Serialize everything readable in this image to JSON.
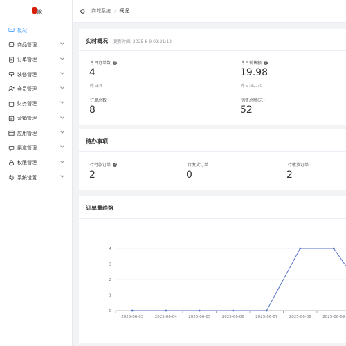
{
  "sidebar": {
    "logo_text": "微",
    "items": [
      {
        "label": "概况",
        "icon": "monitor-icon",
        "active": true,
        "arrow": false
      },
      {
        "label": "商品管理",
        "icon": "goods-icon",
        "active": false,
        "arrow": true
      },
      {
        "label": "订单管理",
        "icon": "order-icon",
        "active": false,
        "arrow": true
      },
      {
        "label": "装修管理",
        "icon": "brush-icon",
        "active": false,
        "arrow": true
      },
      {
        "label": "会员管理",
        "icon": "user-icon",
        "active": false,
        "arrow": true
      },
      {
        "label": "财务管理",
        "icon": "wallet-icon",
        "active": false,
        "arrow": true
      },
      {
        "label": "营销管理",
        "icon": "promo-icon",
        "active": false,
        "arrow": true
      },
      {
        "label": "应用管理",
        "icon": "apps-icon",
        "active": false,
        "arrow": true
      },
      {
        "label": "渠道管理",
        "icon": "channel-icon",
        "active": false,
        "arrow": true
      },
      {
        "label": "权限管理",
        "icon": "lock-icon",
        "active": false,
        "arrow": true
      },
      {
        "label": "系统设置",
        "icon": "gear-icon",
        "active": false,
        "arrow": true
      }
    ]
  },
  "header": {
    "breadcrumb": [
      "商城系统",
      "概况"
    ],
    "separator": "/"
  },
  "realtime": {
    "title": "实时概况",
    "updated": "更新时间: 2025-6-9 02:21:12",
    "stats": [
      {
        "label": "今日订单数",
        "value": "4",
        "sub": "昨日:4",
        "help": true
      },
      {
        "label": "今日销售额",
        "value": "19.98",
        "sub": "昨日:32.70",
        "help": true
      },
      {
        "label": "订单总数",
        "value": "8",
        "sub": "",
        "help": false
      },
      {
        "label": "销售总额(元)",
        "value": "52",
        "sub": "",
        "help": false
      }
    ]
  },
  "todo": {
    "title": "待办事项",
    "items": [
      {
        "label": "待付款订单",
        "value": "2",
        "help": true
      },
      {
        "label": "待发货订单",
        "value": "0",
        "help": false
      },
      {
        "label": "待收货订单",
        "value": "2",
        "help": false
      }
    ]
  },
  "trend": {
    "title": "订单量趋势"
  },
  "chart_data": {
    "type": "line",
    "title": "订单量趋势",
    "x": [
      "2025-06-03",
      "2025-06-04",
      "2025-06-05",
      "2025-06-06",
      "2025-06-07",
      "2025-06-08",
      "2025-06-09"
    ],
    "series": [
      {
        "values": [
          0,
          0,
          0,
          0,
          0,
          4,
          4
        ]
      }
    ],
    "yticks": [
      "0",
      "1",
      "2",
      "3",
      "4"
    ],
    "ylim": [
      0,
      4
    ],
    "grid": true,
    "color": "#5470c6"
  },
  "colors": {
    "accent": "#409eff",
    "line": "#5470c6"
  }
}
